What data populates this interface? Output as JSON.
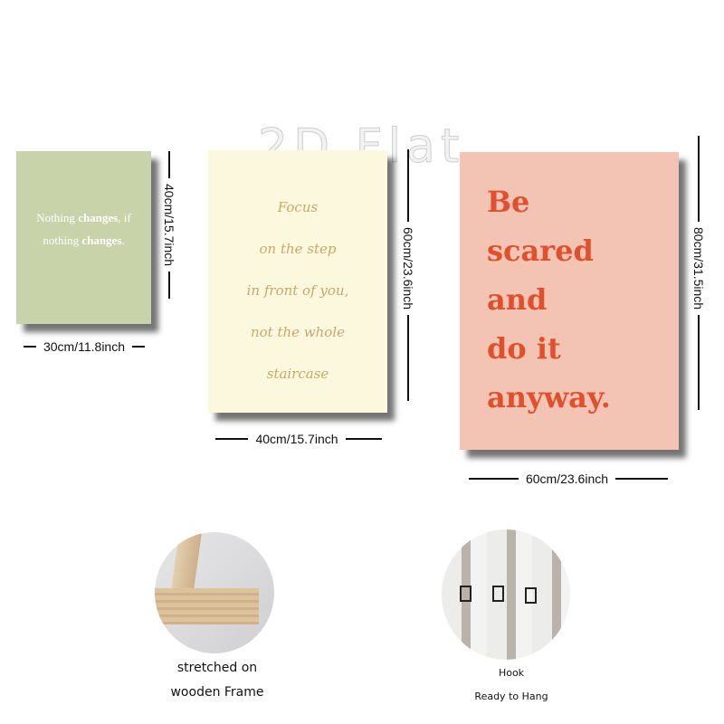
{
  "watermark": "2D Flat",
  "posters": [
    {
      "lines": [
        "Nothing <b>changes</b>, if",
        "nothing <b>changes</b>."
      ],
      "plain": "Nothing changes, if nothing changes.",
      "width_label": "30cm/11.8inch",
      "height_label": "40cm/15.7inch",
      "color": "#c8d3a9"
    },
    {
      "lines": [
        "Focus",
        "on the step",
        "in front of you,",
        "not the whole",
        "staircase"
      ],
      "width_label": "40cm/15.7inch",
      "height_label": "60cm/23.6inch",
      "color": "#fcf8dd"
    },
    {
      "lines": [
        "Be",
        "scared",
        "and",
        "do it",
        "anyway."
      ],
      "width_label": "60cm/23.6inch",
      "height_label": "80cm/31.5inch",
      "color": "#f3c3b4",
      "text_color": "#e0502c"
    }
  ],
  "features": [
    {
      "caption_1": "stretched on",
      "caption_2": "wooden Frame",
      "icon": "wooden-frame-photo"
    },
    {
      "caption_1": "Hook",
      "caption_2": "Ready to Hang",
      "icon": "hook-photo"
    }
  ]
}
